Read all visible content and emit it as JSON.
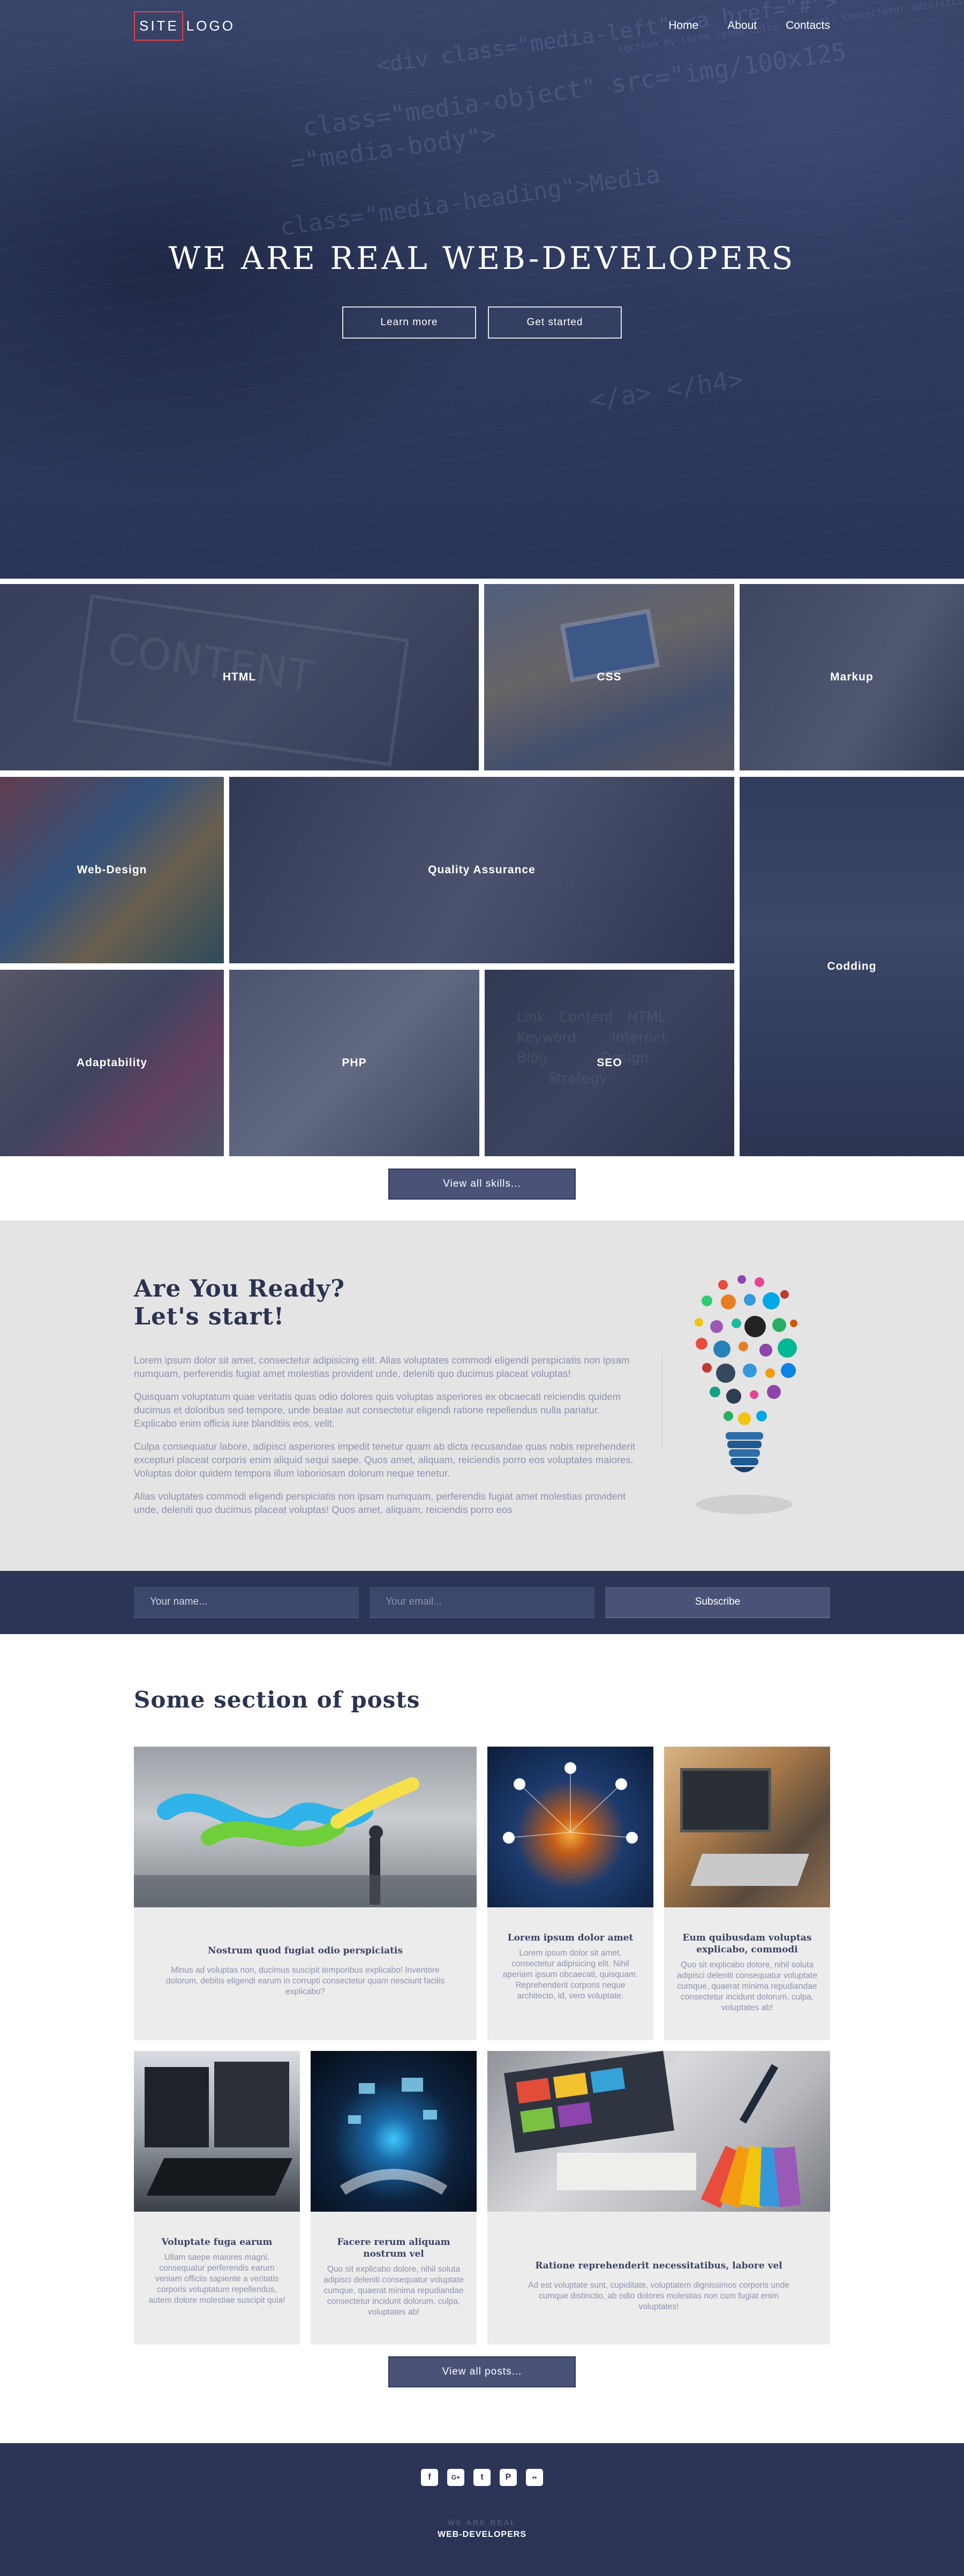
{
  "header": {
    "logo_boxed": "SITE",
    "logo_rest": "LOGO",
    "nav": [
      {
        "label": "Home"
      },
      {
        "label": "About"
      },
      {
        "label": "Contacts"
      }
    ]
  },
  "hero": {
    "title": "WE ARE REAL WEB-DEVELOPERS",
    "learn_more": "Learn more",
    "get_started": "Get started"
  },
  "skills": {
    "tiles": [
      {
        "label": "HTML"
      },
      {
        "label": "CSS"
      },
      {
        "label": "Markup"
      },
      {
        "label": "Web-Design"
      },
      {
        "label": "Quality Assurance"
      },
      {
        "label": "Codding"
      },
      {
        "label": "Adaptability"
      },
      {
        "label": "PHP"
      },
      {
        "label": "SEO"
      }
    ],
    "view_all": "View all skills..."
  },
  "ready": {
    "title_line1": "Are You Ready?",
    "title_line2": "Let's start!",
    "paragraphs": [
      "Lorem ipsum dolor sit amet, consectetur adipisicing elit. Alias voluptates commodi eligendi perspiciatis non ipsam numquam, perferendis fugiat amet molestias provident unde, deleniti quo ducimus placeat voluptas!",
      "Quisquam voluptatum quae veritatis quas odio dolores quis voluptas asperiores ex obcaecati reiciendis quidem ducimus et doloribus sed tempore, unde beatae aut consectetur eligendi ratione repellendus nulla pariatur. Explicabo enim officia iure blanditiis eos, velit.",
      "Culpa consequatur labore, adipisci asperiores impedit tenetur quam ab dicta recusandae quas nobis reprehenderit excepturi placeat corporis enim aliquid sequi saepe. Quos amet, aliquam, reiciendis porro eos voluptates maiores. Voluptas dolor quidem tempora illum laboriosam dolorum neque tenetur.",
      "Alias voluptates commodi eligendi perspiciatis non ipsam numquam, perferendis fugiat amet molestias provident unde, deleniti quo ducimus placeat voluptas! Quos amet, aliquam, reiciendis porro eos"
    ]
  },
  "subscribe": {
    "name_placeholder": "Your name...",
    "email_placeholder": "Your email...",
    "button": "Subscribe"
  },
  "posts": {
    "title": "Some section of posts",
    "items": [
      {
        "title": "Nostrum quod fugiat odio perspiciatis",
        "text": "Minus ad voluptas non, ducimus suscipit temporibus explicabo! Inventore dolorum, debitis eligendi earum in corrupti consectetur quam nesciunt facilis explicabo?"
      },
      {
        "title": "Lorem ipsum dolor amet",
        "text": "Lorem ipsum dolor sit amet, consectetur adipisicing elit. Nihil aperiam ipsum obcaecati, quisquam. Reprehenderit corporis neque architecto, id, vero voluptate."
      },
      {
        "title": "Eum quibusdam voluptas explicabo, commodi",
        "text": "Quo sit explicabo dolore, nihil soluta adipisci deleniti consequatur voluptate cumque, quaerat minima repudiandae consectetur incidunt dolorum, culpa, voluptates ab!"
      },
      {
        "title": "Voluptate fuga earum",
        "text": "Ullam saepe maiores magni, consequatur perferendis earum veniam officiis sapiente a veritatis corporis voluptatum repellendus, autem dolore molestiae suscipit quia!"
      },
      {
        "title": "Facere rerum aliquam nostrum vel",
        "text": "Quo sit explicabo dolore, nihil soluta adipisci deleniti consequatur voluptate cumque, quaerat minima repudiandae consectetur incidunt dolorum, culpa, voluptates ab!"
      },
      {
        "title": "Ratione reprehenderit necessitatibus, labore vel",
        "text": "Ad est voluptate sunt, cupiditate, voluptatem dignissimos corporis unde cumque distinctio, ab odio dolores molestias non cum fugiat enim voluptates!"
      }
    ],
    "view_all": "View all posts..."
  },
  "footer": {
    "socials": [
      {
        "icon": "facebook-icon",
        "glyph": "f"
      },
      {
        "icon": "google-plus-icon",
        "glyph": "G+"
      },
      {
        "icon": "twitter-icon",
        "glyph": "t"
      },
      {
        "icon": "pinterest-icon",
        "glyph": "P"
      },
      {
        "icon": "flickr-icon",
        "glyph": "••"
      }
    ],
    "tagline_small": "WE ARE REAL",
    "tagline_big": "WEB-DEVELOPERS"
  },
  "colors": {
    "navy": "#2c3558",
    "button": "#4a5377",
    "accent_red": "#e0433c",
    "panel": "#e4e4e4"
  }
}
